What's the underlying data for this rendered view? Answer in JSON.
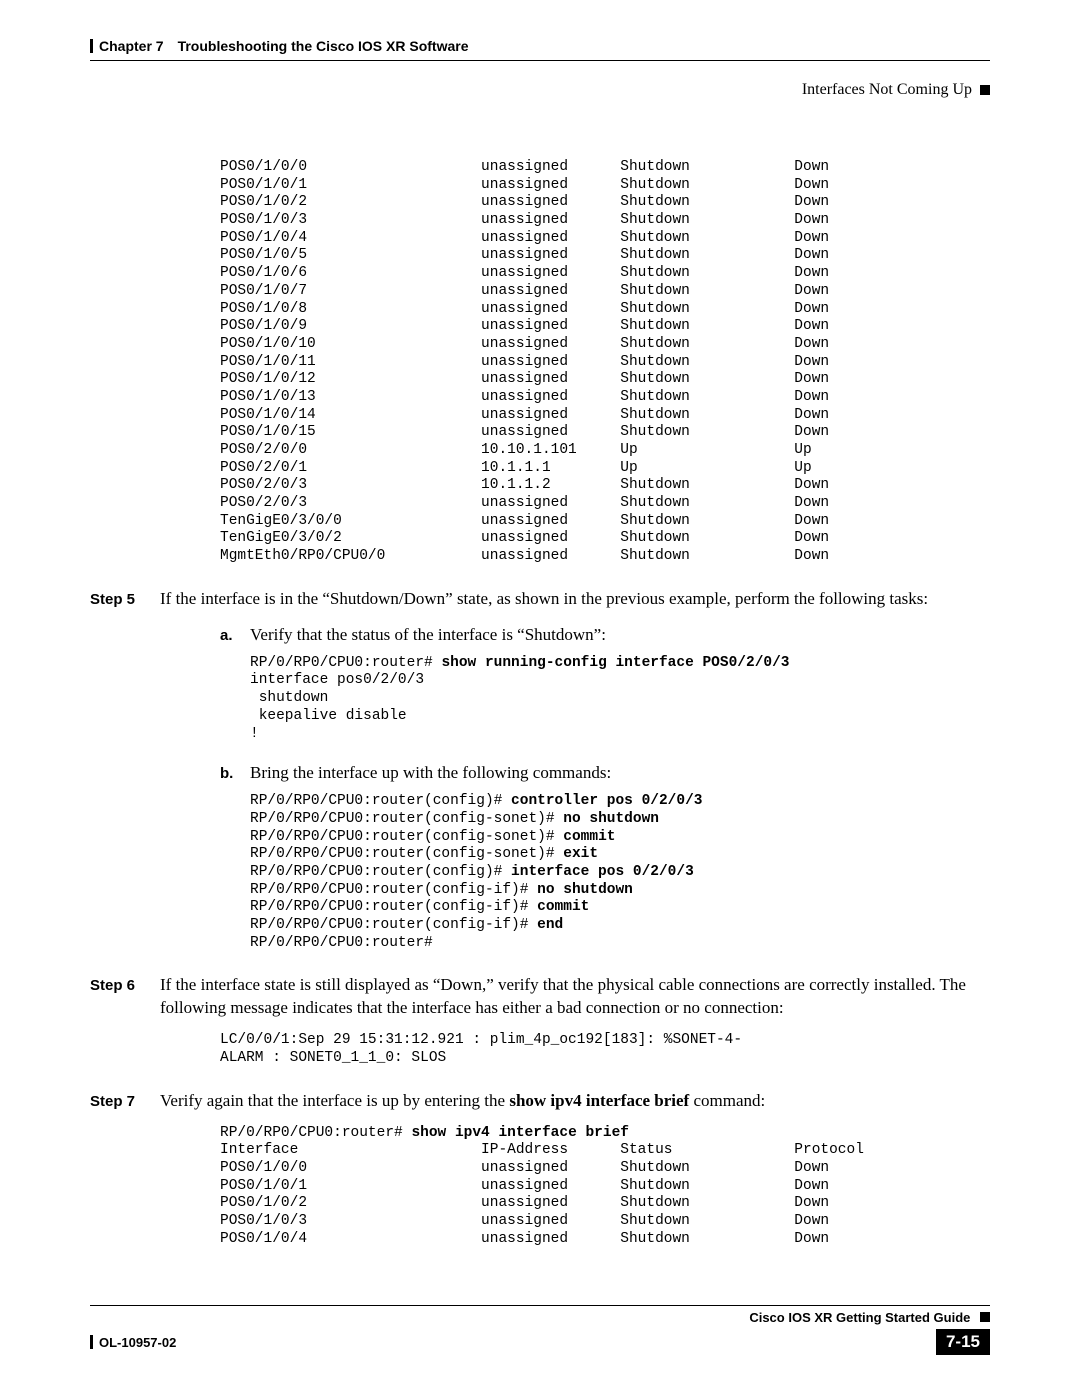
{
  "header": {
    "chapter": "Chapter 7",
    "title": "Troubleshooting the Cisco IOS XR Software",
    "section": "Interfaces Not Coming Up"
  },
  "topTable": "POS0/1/0/0                    unassigned      Shutdown            Down\nPOS0/1/0/1                    unassigned      Shutdown            Down\nPOS0/1/0/2                    unassigned      Shutdown            Down\nPOS0/1/0/3                    unassigned      Shutdown            Down\nPOS0/1/0/4                    unassigned      Shutdown            Down\nPOS0/1/0/5                    unassigned      Shutdown            Down\nPOS0/1/0/6                    unassigned      Shutdown            Down\nPOS0/1/0/7                    unassigned      Shutdown            Down\nPOS0/1/0/8                    unassigned      Shutdown            Down\nPOS0/1/0/9                    unassigned      Shutdown            Down\nPOS0/1/0/10                   unassigned      Shutdown            Down\nPOS0/1/0/11                   unassigned      Shutdown            Down\nPOS0/1/0/12                   unassigned      Shutdown            Down\nPOS0/1/0/13                   unassigned      Shutdown            Down\nPOS0/1/0/14                   unassigned      Shutdown            Down\nPOS0/1/0/15                   unassigned      Shutdown            Down\nPOS0/2/0/0                    10.10.1.101     Up                  Up\nPOS0/2/0/1                    10.1.1.1        Up                  Up\nPOS0/2/0/3                    10.1.1.2        Shutdown            Down\nPOS0/2/0/3                    unassigned      Shutdown            Down\nTenGigE0/3/0/0                unassigned      Shutdown            Down\nTenGigE0/3/0/2                unassigned      Shutdown            Down\nMgmtEth0/RP0/CPU0/0           unassigned      Shutdown            Down",
  "step5": {
    "label": "Step 5",
    "text": "If the interface is in the “Shutdown/Down” state, as shown in the previous example, perform the following tasks:",
    "a": {
      "label": "a.",
      "text": "Verify that the status of the interface is “Shutdown”:",
      "prompt": "RP/0/RP0/CPU0:router# ",
      "cmd": "show running-config interface POS0/2/0/3",
      "output": "\ninterface pos0/2/0/3\n shutdown\n keepalive disable\n!"
    },
    "b": {
      "label": "b.",
      "text": "Bring the interface up with the following commands:",
      "lines": [
        {
          "p": "RP/0/RP0/CPU0:router(config)# ",
          "c": "controller pos 0/2/0/3"
        },
        {
          "p": "RP/0/RP0/CPU0:router(config-sonet)# ",
          "c": "no shutdown"
        },
        {
          "p": "RP/0/RP0/CPU0:router(config-sonet)# ",
          "c": "commit"
        },
        {
          "p": "RP/0/RP0/CPU0:router(config-sonet)# ",
          "c": "exit"
        },
        {
          "p": "RP/0/RP0/CPU0:router(config)# ",
          "c": "interface pos 0/2/0/3"
        },
        {
          "p": "RP/0/RP0/CPU0:router(config-if)# ",
          "c": "no shutdown"
        },
        {
          "p": "RP/0/RP0/CPU0:router(config-if)# ",
          "c": "commit"
        },
        {
          "p": "RP/0/RP0/CPU0:router(config-if)# ",
          "c": "end"
        },
        {
          "p": "RP/0/RP0/CPU0:router#",
          "c": ""
        }
      ]
    }
  },
  "step6": {
    "label": "Step 6",
    "text": "If the interface state is still displayed as “Down,” verify that the physical cable connections are correctly installed. The following message indicates that the interface has either a bad connection or no connection:",
    "output": "LC/0/0/1:Sep 29 15:31:12.921 : plim_4p_oc192[183]: %SONET-4-\nALARM : SONET0_1_1_0: SLOS"
  },
  "step7": {
    "label": "Step 7",
    "textBefore": "Verify again that the interface is up by entering the ",
    "boldCmd": "show ipv4 interface brief",
    "textAfter": " command:",
    "prompt": "RP/0/RP0/CPU0:router# ",
    "cmd": "show ipv4 interface brief",
    "output": "\nInterface                     IP-Address      Status              Protocol\nPOS0/1/0/0                    unassigned      Shutdown            Down\nPOS0/1/0/1                    unassigned      Shutdown            Down\nPOS0/1/0/2                    unassigned      Shutdown            Down\nPOS0/1/0/3                    unassigned      Shutdown            Down\nPOS0/1/0/4                    unassigned      Shutdown            Down"
  },
  "footer": {
    "guide": "Cisco IOS XR Getting Started Guide",
    "docid": "OL-10957-02",
    "pagenum": "7-15"
  }
}
